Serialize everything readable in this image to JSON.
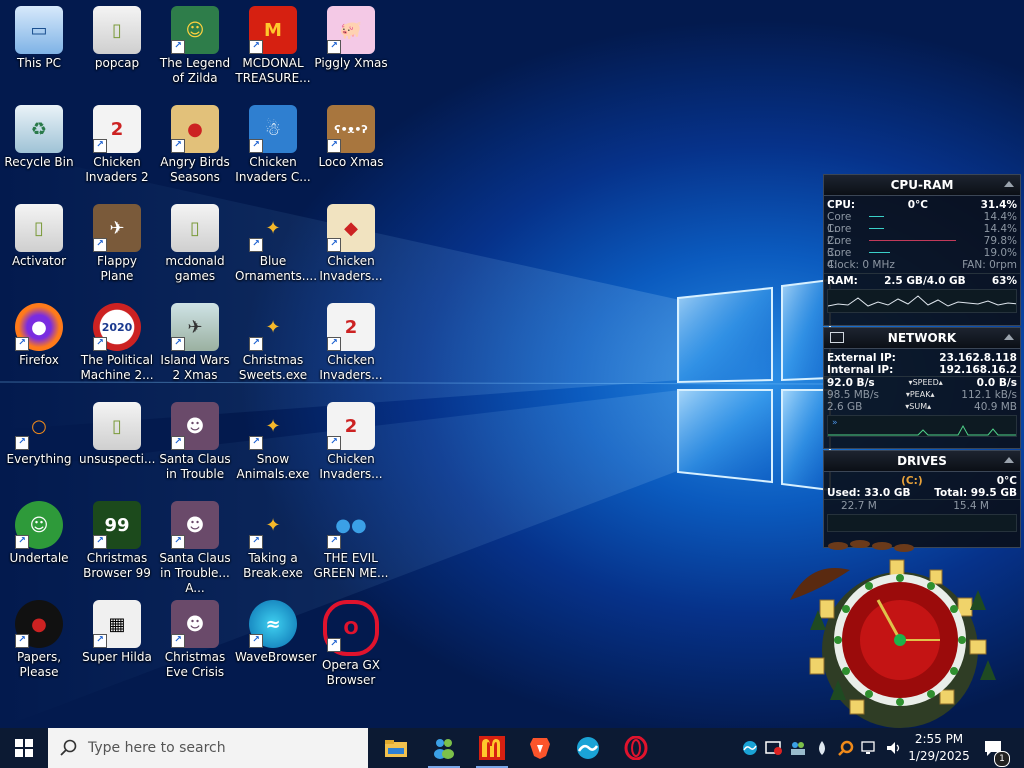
{
  "desktop_icons": [
    {
      "label": "This PC",
      "icon": "this-pc-icon",
      "shortcut": false
    },
    {
      "label": "popcap",
      "icon": "folder-icon",
      "shortcut": false
    },
    {
      "label": "The Legend of Zilda",
      "icon": "game-icon",
      "shortcut": true
    },
    {
      "label": "MCDONAL TREASURE...",
      "icon": "mcdonalds-icon",
      "shortcut": true
    },
    {
      "label": "Piggly Xmas",
      "icon": "pig-icon",
      "shortcut": true
    },
    {
      "label": "Recycle Bin",
      "icon": "recycle-bin-icon",
      "shortcut": false
    },
    {
      "label": "Chicken Invaders 2",
      "icon": "chicken-icon",
      "shortcut": true
    },
    {
      "label": "Angry Birds Seasons",
      "icon": "angry-birds-icon",
      "shortcut": true
    },
    {
      "label": "Chicken Invaders C...",
      "icon": "snowman-icon",
      "shortcut": true
    },
    {
      "label": "Loco Xmas",
      "icon": "teddy-bear-icon",
      "shortcut": true
    },
    {
      "label": "Activator",
      "icon": "folder-icon",
      "shortcut": false
    },
    {
      "label": "Flappy Plane",
      "icon": "plane-icon",
      "shortcut": true
    },
    {
      "label": "mcdonald games",
      "icon": "folder-icon",
      "shortcut": false
    },
    {
      "label": "Blue Ornaments....",
      "icon": "program-icon",
      "shortcut": true
    },
    {
      "label": "Chicken Invaders...",
      "icon": "chicken-santa-icon",
      "shortcut": true
    },
    {
      "label": "Firefox",
      "icon": "firefox-icon",
      "shortcut": true
    },
    {
      "label": "The Political Machine 2...",
      "icon": "political-machine-icon",
      "shortcut": true
    },
    {
      "label": "Island Wars 2 Xmas",
      "icon": "island-wars-icon",
      "shortcut": true
    },
    {
      "label": "Christmas Sweets.exe",
      "icon": "program-icon",
      "shortcut": true
    },
    {
      "label": "Chicken Invaders...",
      "icon": "chicken-icon",
      "shortcut": true
    },
    {
      "label": "Everything",
      "icon": "search-icon",
      "shortcut": true
    },
    {
      "label": "unsuspecti...",
      "icon": "folder-icon",
      "shortcut": false
    },
    {
      "label": "Santa Claus in Trouble",
      "icon": "santa-icon",
      "shortcut": true
    },
    {
      "label": "Snow Animals.exe",
      "icon": "program-icon",
      "shortcut": true
    },
    {
      "label": "Chicken Invaders...",
      "icon": "chicken-icon",
      "shortcut": true
    },
    {
      "label": "Undertale",
      "icon": "undertale-icon",
      "shortcut": true
    },
    {
      "label": "Christmas Browser 99",
      "icon": "christmas-tree-icon",
      "shortcut": true
    },
    {
      "label": "Santa Claus in Trouble... A...",
      "icon": "santa-icon",
      "shortcut": true
    },
    {
      "label": "Taking a Break.exe",
      "icon": "program-icon",
      "shortcut": true
    },
    {
      "label": "THE EVIL GREEN ME...",
      "icon": "messenger-icon",
      "shortcut": true
    },
    {
      "label": "Papers, Please",
      "icon": "papers-please-icon",
      "shortcut": true
    },
    {
      "label": "Super Hilda",
      "icon": "super-hilda-icon",
      "shortcut": true
    },
    {
      "label": "Christmas Eve Crisis",
      "icon": "santa-icon",
      "shortcut": true
    },
    {
      "label": "WaveBrowser",
      "icon": "wavebrowser-icon",
      "shortcut": true
    },
    {
      "label": "Opera GX Browser",
      "icon": "opera-gx-icon",
      "shortcut": true
    }
  ],
  "cpu_ram": {
    "title": "CPU-RAM",
    "cpu_label": "CPU:",
    "cpu_temp": "0°C",
    "cpu_value": "31.4%",
    "cores": [
      {
        "label": "Core 1:",
        "value": "14.4%",
        "level": 0.144
      },
      {
        "label": "Core 2:",
        "value": "14.4%",
        "level": 0.144
      },
      {
        "label": "Core 3:",
        "value": "79.8%",
        "level": 0.798
      },
      {
        "label": "Core 4:",
        "value": "19.0%",
        "level": 0.19
      }
    ],
    "clock": "Clock: 0 MHz",
    "fan": "FAN: 0rpm",
    "ram_label": "RAM:",
    "ram_value": "2.5 GB/4.0 GB",
    "ram_percent": "63%"
  },
  "network": {
    "title": "NETWORK",
    "external_label": "External IP:",
    "external_ip": "23.162.8.118",
    "internal_label": "Internal IP:",
    "internal_ip": "192.168.16.2",
    "speed_down": "92.0 B/s",
    "speed_label": "SPEED",
    "speed_up": "0.0 B/s",
    "peak_down": "98.5 MB/s",
    "peak_label": "PEAK",
    "peak_up": "112.1 kB/s",
    "sum_down": "2.6 GB",
    "sum_label": "SUM",
    "sum_up": "40.9 MB"
  },
  "drives": {
    "title": "DRIVES",
    "drive_letter": "(C:)",
    "temp": "0°C",
    "used": "Used: 33.0 GB",
    "total": "Total: 99.5 GB",
    "read": "22.7 M",
    "write": "15.4 M"
  },
  "taskbar": {
    "search_placeholder": "Type here to search",
    "apps": [
      {
        "name": "file-explorer-icon",
        "active": false
      },
      {
        "name": "messenger-icon",
        "active": true
      },
      {
        "name": "mcdonalds-icon",
        "active": true
      },
      {
        "name": "brave-icon",
        "active": false
      },
      {
        "name": "wavebrowser-icon",
        "active": false
      },
      {
        "name": "opera-icon",
        "active": false
      }
    ],
    "time": "2:55 PM",
    "date": "1/29/2025",
    "notification_count": "1"
  },
  "colors": {
    "taskbar": "#0c1a33",
    "gadget_bg": "#0a0e16",
    "wallpaper": "#0b5bbf"
  }
}
